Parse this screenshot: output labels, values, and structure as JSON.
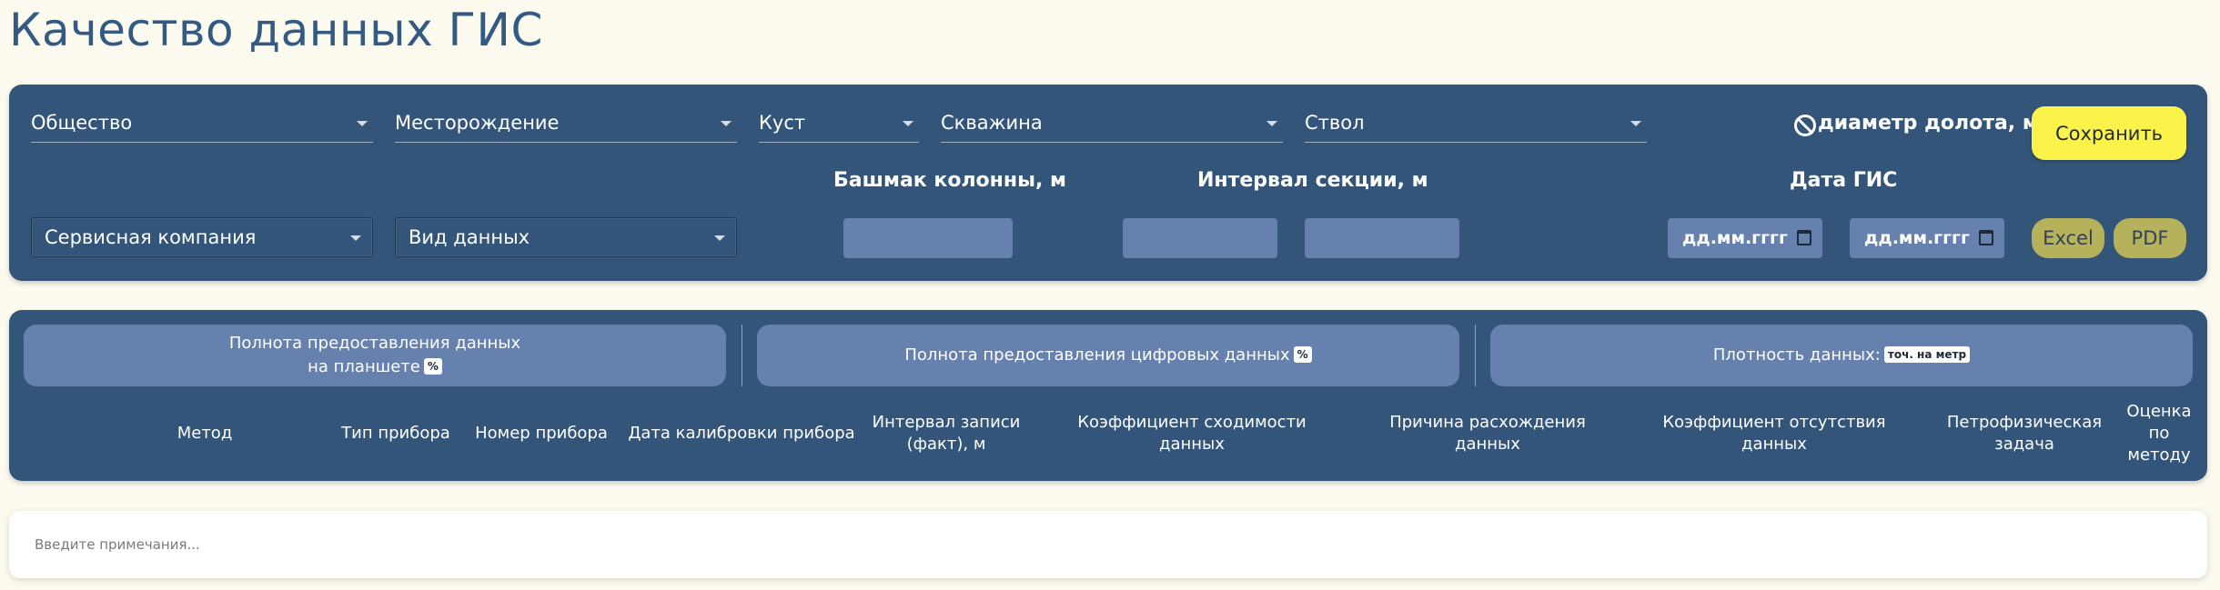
{
  "page": {
    "title": "Качество данных ГИС"
  },
  "filters": {
    "company": "Общество",
    "field": "Месторождение",
    "pad": "Куст",
    "well": "Скважина",
    "wellbore": "Ствол",
    "service_company": "Сервисная компания",
    "data_type": "Вид данных",
    "bit_diameter_label": "диаметр долота, мм",
    "casing_shoe_label": "Башмак колонны, м",
    "section_interval_label": "Интервал секции, м",
    "gis_date_label": "Дата ГИС",
    "date_from_placeholder": "дд.мм.гггг",
    "date_to_placeholder": "дд.мм.гггг",
    "save_label": "Сохранить",
    "excel_label": "Excel",
    "pdf_label": "PDF"
  },
  "metrics": [
    {
      "line1": "Полнота предоставления данных",
      "line2": "на планшете",
      "badge": "%"
    },
    {
      "label": "Полнота предоставления цифровых данных",
      "badge": "%"
    },
    {
      "label": "Плотность данных:",
      "badge": "точ. на метр"
    }
  ],
  "table": {
    "columns": [
      "Метод",
      "Тип прибора",
      "Номер прибора",
      "Дата калибровки прибора",
      "Интервал записи (факт), м",
      "Коэффициент сходимости данных",
      "Причина расхождения данных",
      "Коэффициент отсутствия данных",
      "Петрофизическая задача",
      "Оценка по методу"
    ]
  },
  "notes": {
    "placeholder": "Введите примечания..."
  },
  "colors": {
    "background": "#fdfaef",
    "panel": "#34557a",
    "input": "#6681ae",
    "title": "#325a83",
    "save": "#fbf24a",
    "export": "#b5b25b"
  }
}
